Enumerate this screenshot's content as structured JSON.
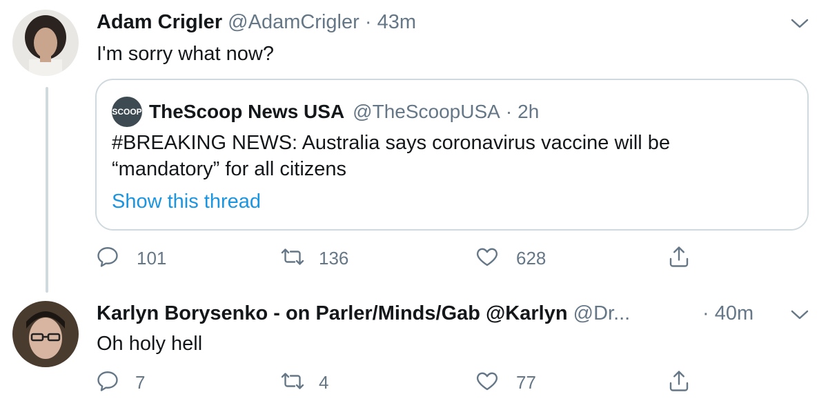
{
  "tweet1": {
    "display_name": "Adam Crigler",
    "handle": "@AdamCrigler",
    "separator": "·",
    "time": "43m",
    "text": "I'm sorry what now?",
    "quote": {
      "logo_text": "SCOOP",
      "display_name": "TheScoop News USA",
      "handle": "@TheScoopUSA",
      "separator": "·",
      "time": "2h",
      "text_line1": "#BREAKING NEWS: Australia says coronavirus vaccine will be",
      "text_line2": "“mandatory” for all citizens",
      "show_thread": "Show this thread"
    },
    "replies": "101",
    "retweets": "136",
    "likes": "628"
  },
  "tweet2": {
    "display_name": "Karlyn Borysenko - on Parler/Minds/Gab @Karlyn",
    "handle": "@Dr...",
    "separator": "·",
    "time": "40m",
    "text": "Oh holy hell",
    "replies": "7",
    "retweets": "4",
    "likes": "77"
  },
  "icons": {
    "reply": "reply-icon",
    "retweet": "retweet-icon",
    "like": "heart-icon",
    "share": "share-icon",
    "menu": "chevron-down-icon"
  },
  "colors": {
    "text": "#14171a",
    "muted": "#657786",
    "link": "#1b95e0",
    "border": "#cfd9de"
  }
}
